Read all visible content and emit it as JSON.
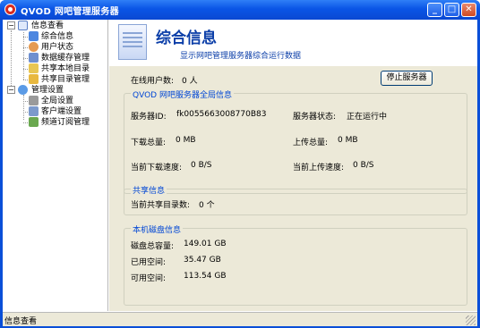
{
  "window": {
    "title": "QVOD 网吧管理服务器",
    "minimize": "_",
    "maximize": "□",
    "close": "✕"
  },
  "colors": {
    "titlebar": "#0a55e6",
    "accent": "#0b3ea8",
    "group_title": "#0046d5",
    "panel_bg": "#ece9d8"
  },
  "tree": {
    "expander_open": "−",
    "nodes": [
      {
        "label": "信息查看",
        "icon": "document-icon",
        "children": [
          {
            "label": "综合信息",
            "icon": "info-icon"
          },
          {
            "label": "用户状态",
            "icon": "user-icon"
          },
          {
            "label": "数据缓存管理",
            "icon": "cache-icon"
          },
          {
            "label": "共享本地目录",
            "icon": "share-folder-icon"
          },
          {
            "label": "共享目录管理",
            "icon": "folder-icon"
          }
        ]
      },
      {
        "label": "管理设置",
        "icon": "globe-icon",
        "children": [
          {
            "label": "全局设置",
            "icon": "tools-icon"
          },
          {
            "label": "客户端设置",
            "icon": "client-icon"
          },
          {
            "label": "频道订阅管理",
            "icon": "channel-icon"
          }
        ]
      }
    ]
  },
  "header": {
    "title": "综合信息",
    "subtitle": "显示网吧管理服务器综合运行数据"
  },
  "online": {
    "label": "在线用户数:",
    "value": "0 人"
  },
  "stop_button": "停止服务器",
  "server_group": {
    "title": "QVOD 网吧服务器全局信息",
    "server_id_label": "服务器ID:",
    "server_id_value": "fk0055663008770B83",
    "server_status_label": "服务器状态:",
    "server_status_value": "正在运行中",
    "download_total_label": "下载总量:",
    "download_total_value": "0 MB",
    "upload_total_label": "上传总量:",
    "upload_total_value": "0 MB",
    "download_speed_label": "当前下载速度:",
    "download_speed_value": "0 B/S",
    "upload_speed_label": "当前上传速度:",
    "upload_speed_value": "0 B/S"
  },
  "share_group": {
    "title": "共享信息",
    "dir_count_label": "当前共享目录数:",
    "dir_count_value": "0 个"
  },
  "disk_group": {
    "title": "本机磁盘信息",
    "total_label": "磁盘总容量:",
    "total_value": "149.01 GB",
    "used_label": "已用空间:",
    "used_value": "35.47 GB",
    "free_label": "可用空间:",
    "free_value": "113.54 GB"
  },
  "statusbar": {
    "text": "信息查看"
  }
}
